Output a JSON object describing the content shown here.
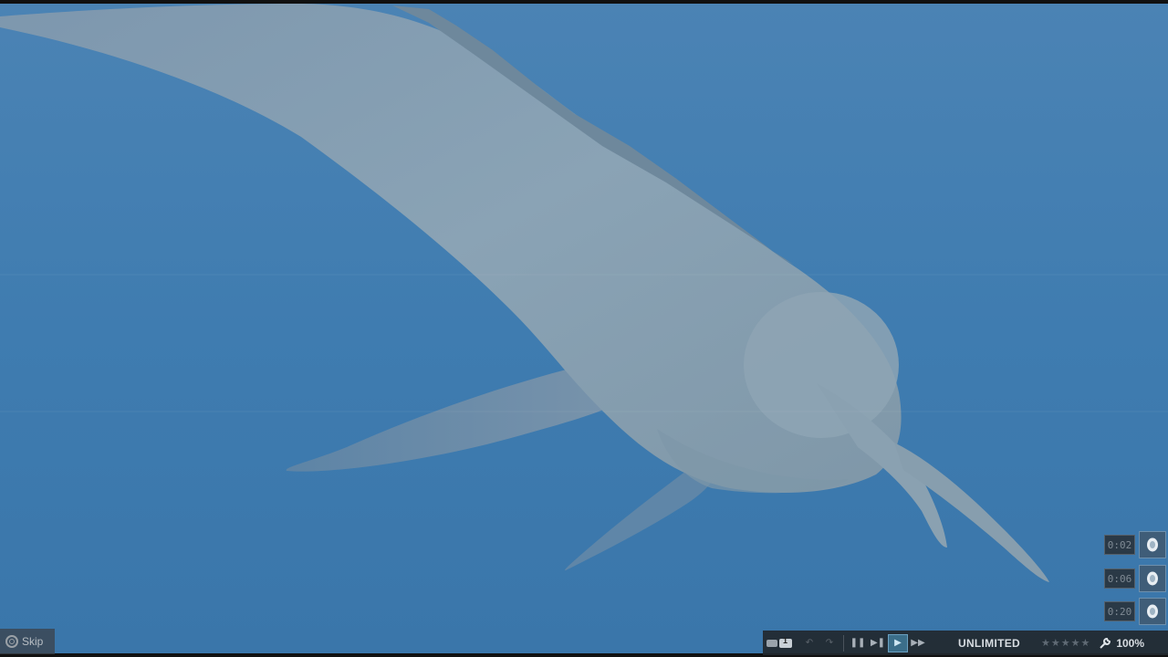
{
  "scene": {
    "description_icon": "swimming-mosasaurus-scene",
    "water_color": "#3d79ad"
  },
  "skip": {
    "label": "Skip",
    "icon": "controller-button-icon"
  },
  "timers": [
    {
      "time": "0:02",
      "icon": "incubation-egg-icon"
    },
    {
      "time": "0:06",
      "icon": "incubation-egg-icon"
    },
    {
      "time": "0:20",
      "icon": "incubation-egg-icon"
    }
  ],
  "bottom_bar": {
    "speed_badge": "1",
    "budget": "UNLIMITED",
    "rating_stars": "★★★★★",
    "rating_value": 0,
    "zoom": "100%"
  },
  "colors": {
    "accent": "#3b6e8a",
    "bar_bg": "#22282e"
  }
}
